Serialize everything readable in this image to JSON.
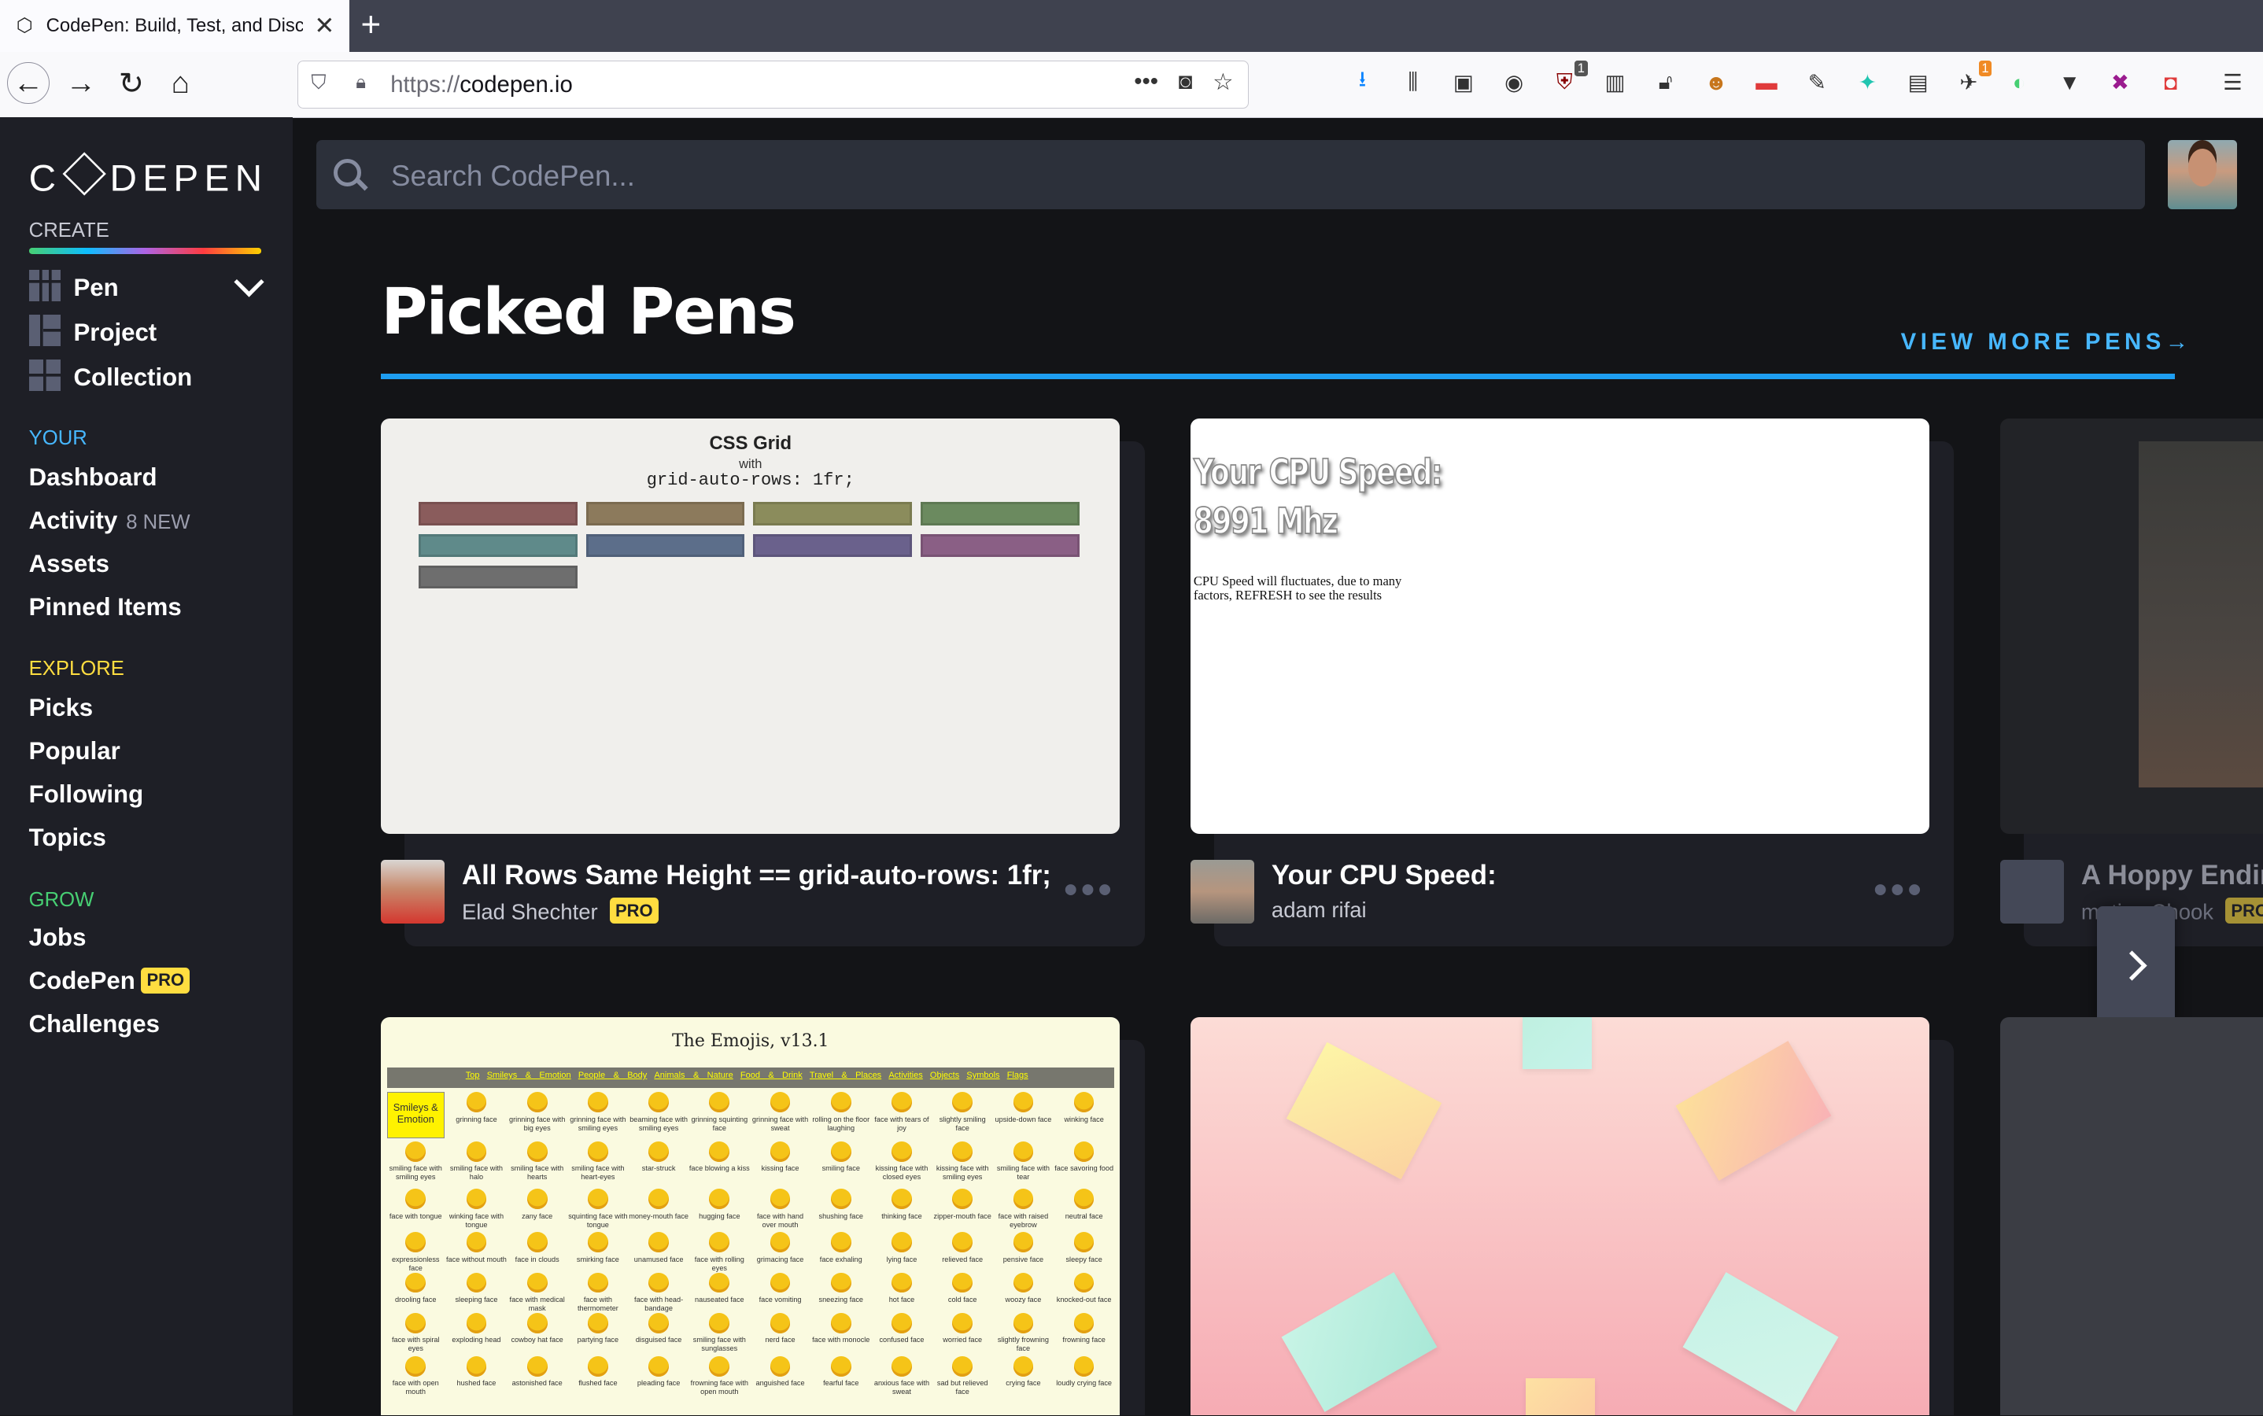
{
  "browser": {
    "tab_title": "CodePen: Build, Test, and Discover Front-end Code",
    "url_protocol": "https://",
    "url_host": "codepen.io",
    "new_tab_label": "+",
    "close_label": "✕",
    "page_actions": "•••",
    "extension_badges": [
      "1",
      "1"
    ]
  },
  "sidebar": {
    "logo": "CODEPEN",
    "create_label": "CREATE",
    "create_items": [
      "Pen",
      "Project",
      "Collection"
    ],
    "your_label": "YOUR",
    "your_items": [
      "Dashboard",
      "Activity",
      "Assets",
      "Pinned Items"
    ],
    "activity_note": "8 NEW",
    "explore_label": "EXPLORE",
    "explore_items": [
      "Picks",
      "Popular",
      "Following",
      "Topics"
    ],
    "grow_label": "GROW",
    "grow_items": [
      "Jobs",
      "CodePen",
      "Challenges"
    ],
    "pro_badge": "PRO",
    "colors": {
      "your": "#47b7ff",
      "explore": "#ffdd40",
      "grow": "#47cf73",
      "create": "#c7c9d3"
    }
  },
  "search": {
    "placeholder": "Search CodePen..."
  },
  "main": {
    "heading": "Picked Pens",
    "view_more": "VIEW MORE PENS",
    "view_more_arrow": "→",
    "cards": [
      {
        "title": "All Rows Same Height == grid-auto-rows: 1fr;",
        "author": "Elad Shechter",
        "pro": "PRO",
        "menu": "•••"
      },
      {
        "title": "Your CPU Speed:",
        "author": "adam rifai",
        "menu": "•••"
      },
      {
        "title": "A Hoppy Ending",
        "author": "matias Chook",
        "pro": "PRO"
      }
    ]
  },
  "preview_grid": {
    "title": "CSS Grid",
    "with": "with",
    "code": "grid-auto-rows: 1fr;",
    "cell_colors": [
      "#8a5c5c",
      "#8c7a5c",
      "#8b8c5c",
      "#6b8a5f",
      "#5f8a8a",
      "#5c6e8a",
      "#6a618c",
      "#8a5f85",
      "#6e6e6e"
    ]
  },
  "preview_cpu": {
    "big_line1": "Your CPU Speed:",
    "big_line2": "8991 Mhz",
    "small": "CPU Speed will fluctuates, due to many factors, REFRESH to see the results"
  },
  "preview_emoji": {
    "title": "The Emojis, v13.1",
    "nav": [
      "Top",
      "Smileys & Emotion",
      "People & Body",
      "Animals & Nature",
      "Food & Drink",
      "Travel & Places",
      "Activities",
      "Objects",
      "Symbols",
      "Flags"
    ],
    "section": "Smileys & Emotion",
    "labels": [
      "grinning face",
      "grinning face with big eyes",
      "grinning face with smiling eyes",
      "beaming face with smiling eyes",
      "grinning squinting face",
      "grinning face with sweat",
      "rolling on the floor laughing",
      "face with tears of joy",
      "slightly smiling face",
      "upside-down face",
      "winking face",
      "smiling face with smiling eyes",
      "smiling face with halo",
      "smiling face with hearts",
      "smiling face with heart-eyes",
      "star-struck",
      "face blowing a kiss",
      "kissing face",
      "smiling face",
      "kissing face with closed eyes",
      "kissing face with smiling eyes",
      "smiling face with tear",
      "face savoring food",
      "face with tongue",
      "winking face with tongue",
      "zany face",
      "squinting face with tongue",
      "money-mouth face",
      "hugging face",
      "face with hand over mouth",
      "shushing face",
      "thinking face",
      "zipper-mouth face",
      "face with raised eyebrow",
      "neutral face",
      "expressionless face",
      "face without mouth",
      "face in clouds",
      "smirking face",
      "unamused face",
      "face with rolling eyes",
      "grimacing face",
      "face exhaling",
      "lying face",
      "relieved face",
      "pensive face",
      "sleepy face",
      "drooling face",
      "sleeping face",
      "face with medical mask",
      "face with thermometer",
      "face with head-bandage",
      "nauseated face",
      "face vomiting",
      "sneezing face",
      "hot face",
      "cold face",
      "woozy face",
      "knocked-out face",
      "face with spiral eyes",
      "exploding head",
      "cowboy hat face",
      "partying face",
      "disguised face",
      "smiling face with sunglasses",
      "nerd face",
      "face with monocle",
      "confused face",
      "worried face",
      "slightly frowning face",
      "frowning face",
      "face with open mouth",
      "hushed face",
      "astonished face",
      "flushed face",
      "pleading face",
      "frowning face with open mouth",
      "anguished face",
      "fearful face",
      "anxious face with sweat",
      "sad but relieved face",
      "crying face",
      "loudly crying face"
    ]
  },
  "preview_colors": {
    "stickies": [
      {
        "color": "#fdf5a6",
        "color2": "#fbd3a0"
      },
      {
        "color": "#bff0e0",
        "color2": "#c6f3ea"
      },
      {
        "color": "#fde09a",
        "color2": "#f9b2b6"
      },
      {
        "color": "#c8f4e6",
        "color2": "#a9e8d7"
      },
      {
        "color": "#c6f2e6",
        "color2": "#d2f5ea"
      },
      {
        "color": "#fde1a3",
        "color2": "#fcc9a0"
      }
    ]
  }
}
